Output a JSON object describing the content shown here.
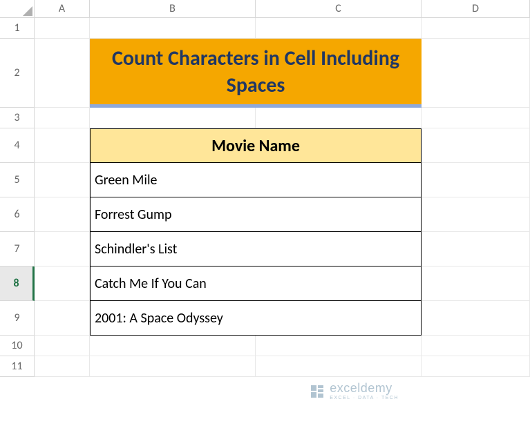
{
  "columns": [
    "A",
    "B",
    "C",
    "D"
  ],
  "rows": [
    "1",
    "2",
    "3",
    "4",
    "5",
    "6",
    "7",
    "8",
    "9",
    "10",
    "11"
  ],
  "selected_row": "8",
  "title": "Count Characters in Cell Including Spaces",
  "table": {
    "header": "Movie Name",
    "rows": [
      "Green Mile",
      "Forrest Gump",
      "Schindler's List",
      "Catch Me If You Can",
      "2001: A Space Odyssey"
    ]
  },
  "watermark": {
    "brand": "exceldemy",
    "tagline": "EXCEL · DATA · TECH"
  }
}
